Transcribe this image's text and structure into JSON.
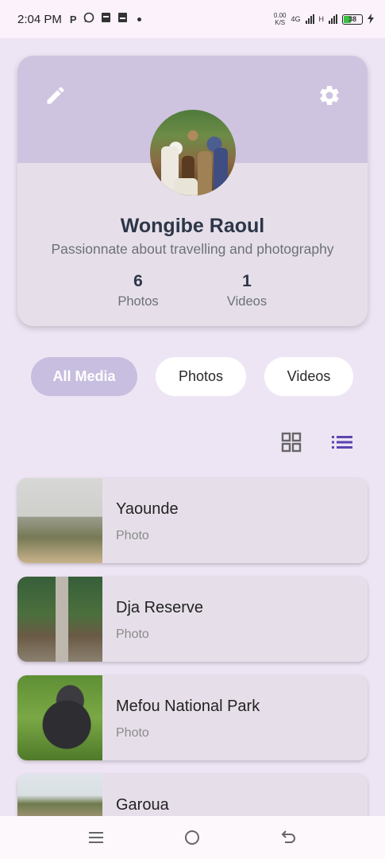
{
  "status_bar": {
    "time": "2:04 PM",
    "left_icons": [
      "P",
      "whatsapp-icon",
      "notification-icon",
      "notification-icon"
    ],
    "net_speed_value": "0.00",
    "net_speed_unit": "K/S",
    "network": "4G",
    "network2": "H",
    "battery": "38"
  },
  "profile": {
    "name": "Wongibe Raoul",
    "bio": "Passionnate about travelling and photography",
    "photos_count": "6",
    "photos_label": "Photos",
    "videos_count": "1",
    "videos_label": "Videos",
    "header_color": "#cfc4e0"
  },
  "filters": {
    "all": "All Media",
    "photos": "Photos",
    "videos": "Videos",
    "selected": "All Media",
    "accent": "#c8bedf"
  },
  "view_toggle": {
    "selected": "list",
    "accent": "#5b45b0"
  },
  "media": [
    {
      "title": "Yaounde",
      "type": "Photo"
    },
    {
      "title": "Dja Reserve",
      "type": "Photo"
    },
    {
      "title": "Mefou National Park",
      "type": "Photo"
    },
    {
      "title": "Garoua",
      "type": ""
    }
  ],
  "icons": {
    "edit": "pencil-icon",
    "settings": "gear-icon",
    "grid": "grid-view-icon",
    "list": "list-view-icon",
    "nav": [
      "menu-icon",
      "home-circle-icon",
      "back-icon"
    ]
  }
}
